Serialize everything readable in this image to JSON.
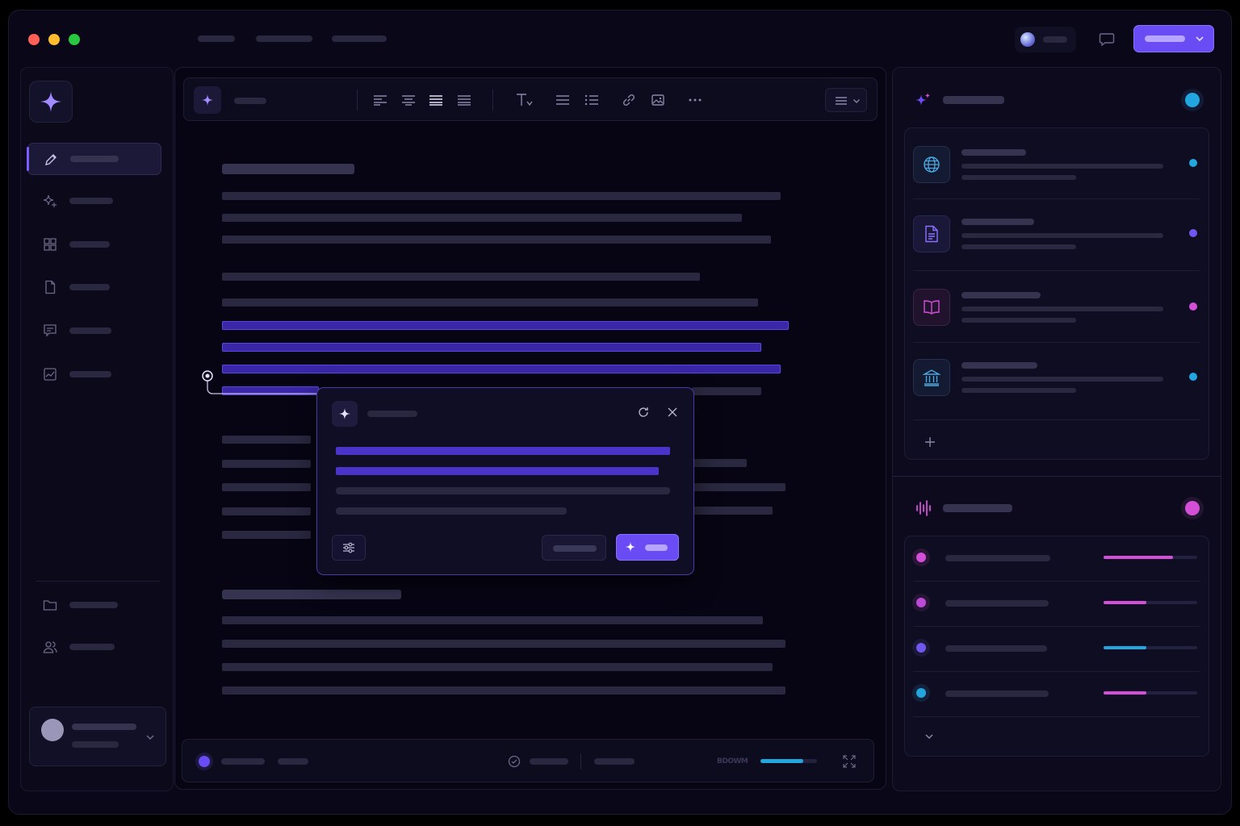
{
  "window": {
    "title_controls": [
      "close",
      "minimize",
      "maximize"
    ]
  },
  "colors": {
    "accent": "#6a4cf5",
    "accent_dark": "#3a27a8",
    "cyan": "#22a6e0",
    "magenta": "#d44fd8",
    "violet": "#7157f0",
    "bg": "#0a0818"
  },
  "header": {
    "menu": [
      "",
      "",
      ""
    ],
    "primary_button": ""
  },
  "sidebar": {
    "items": [
      {
        "icon": "pencil-icon",
        "label": ""
      },
      {
        "icon": "sparkles-icon",
        "label": ""
      },
      {
        "icon": "grid-icon",
        "label": ""
      },
      {
        "icon": "document-icon",
        "label": ""
      },
      {
        "icon": "chat-icon",
        "label": ""
      },
      {
        "icon": "chart-icon",
        "label": ""
      }
    ],
    "bottom_items": [
      {
        "icon": "folder-icon",
        "label": ""
      },
      {
        "icon": "users-icon",
        "label": ""
      }
    ],
    "user": {
      "name": "",
      "role": ""
    }
  },
  "toolbar": {
    "title": ""
  },
  "status_bar": {
    "zoom_label": "BDOWM",
    "progress": 0.75
  },
  "ai_popup": {
    "title": "",
    "secondary_button": "",
    "primary_button": ""
  },
  "sources_panel": {
    "title": "",
    "items": [
      {
        "icon": "globe-icon",
        "status_color": "#22a6e0"
      },
      {
        "icon": "document-icon",
        "status_color": "#7157f0"
      },
      {
        "icon": "book-icon",
        "status_color": "#d44fd8"
      },
      {
        "icon": "bank-icon",
        "status_color": "#22a6e0"
      }
    ]
  },
  "signals_panel": {
    "title": "",
    "items": [
      {
        "color": "#d44fd8",
        "level": 0.74,
        "bar_color": "#d44fd8"
      },
      {
        "color": "#c04ad8",
        "level": 0.46,
        "bar_color": "#d44fd8"
      },
      {
        "color": "#7157f0",
        "level": 0.46,
        "bar_color": "#22a6e0"
      },
      {
        "color": "#22a6e0",
        "level": 0.46,
        "bar_color": "#d44fd8"
      }
    ]
  }
}
